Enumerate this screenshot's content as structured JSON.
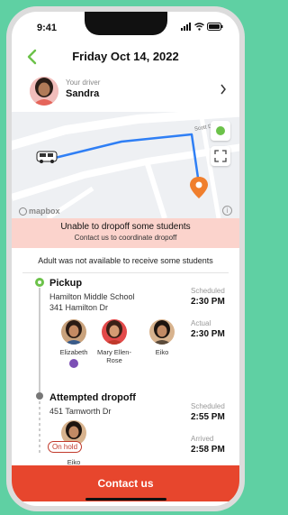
{
  "status": {
    "time": "9:41"
  },
  "header": {
    "title": "Friday Oct 14, 2022"
  },
  "driver": {
    "label": "Your driver",
    "name": "Sandra"
  },
  "map": {
    "street_label": "Scott Dr",
    "watermark": "mapbox"
  },
  "banner": {
    "line1": "Unable to dropoff some students",
    "line2": "Contact us to coordinate dropoff"
  },
  "info_text": "Adult was not available to receive some students",
  "pickup": {
    "title": "Pickup",
    "school": "Hamilton Middle School",
    "address": "341 Hamilton Dr",
    "scheduled_label": "Scheduled",
    "scheduled_time": "2:30 PM",
    "actual_label": "Actual",
    "actual_time": "2:30 PM",
    "students": [
      {
        "name": "Elizabeth",
        "has_badge": true
      },
      {
        "name": "Mary Ellen-Rose",
        "has_badge": false
      },
      {
        "name": "Eiko",
        "has_badge": false
      }
    ]
  },
  "dropoff": {
    "title": "Attempted dropoff",
    "address": "451 Tamworth Dr",
    "scheduled_label": "Scheduled",
    "scheduled_time": "2:55 PM",
    "arrived_label": "Arrived",
    "arrived_time": "2:58 PM",
    "student": {
      "name": "Eiko",
      "status": "On hold"
    }
  },
  "cta": {
    "label": "Contact us"
  },
  "colors": {
    "accent": "#e7462d",
    "green": "#6cc24a",
    "route": "#2f7ff5",
    "banner": "#fbd3cc"
  }
}
